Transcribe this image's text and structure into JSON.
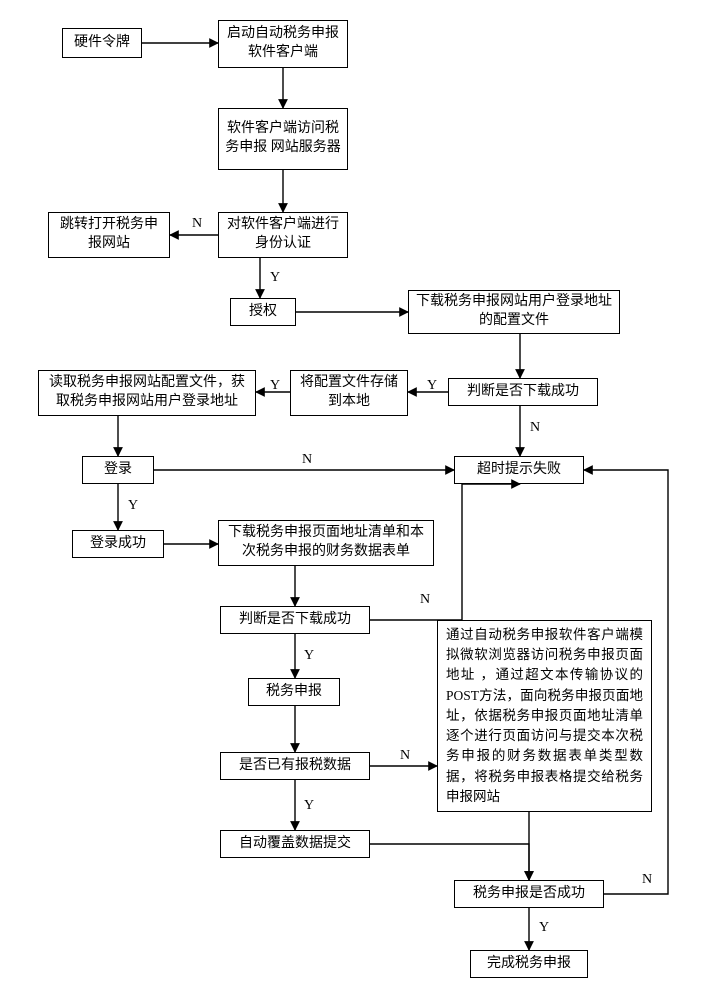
{
  "n": {
    "hw_token": "硬件令牌",
    "start_client": "启动自动税务申报软件客户端",
    "access_server": "软件客户端访问税务申报  网站服务器",
    "auth_client": "对软件客户端进行身份认证",
    "open_site": "跳转打开税务申报网站",
    "authorize": "授权",
    "dl_config": "下载税务申报网站用户登录地址的配置文件",
    "judge_dl1": "判断是否下载成功",
    "save_local": "将配置文件存储到本地",
    "read_config": "读取税务申报网站配置文件，获取税务申报网站用户登录地址",
    "login": "登录",
    "login_ok": "登录成功",
    "dl_forms": "下载税务申报页面地址清单和本次税务申报的财务数据表单",
    "judge_dl2": "判断是否下载成功",
    "tax_declare": "税务申报",
    "has_data": "是否已有报税数据",
    "auto_submit": "自动覆盖数据提交",
    "timeout_fail": "超时提示失败",
    "long_desc": "通过自动税务申报软件客户端模拟微软浏览器访问税务申报页面地址  ，通过超文本传输协议的POST方法，面向税务申报页面地址，依据税务申报页面地址清单逐个进行页面访问与提交本次税务申报的财务数据表单类型数据，将税务申报表格提交给税务申报网站",
    "tax_ok": "税务申报是否成功",
    "done": "完成税务申报"
  },
  "lbl": {
    "Y": "Y",
    "N": "N"
  }
}
